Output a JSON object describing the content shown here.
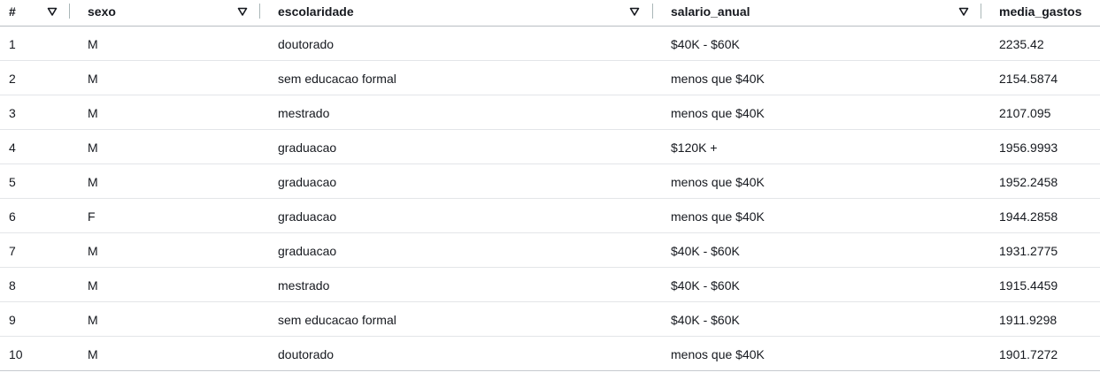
{
  "columns": [
    {
      "label": "#"
    },
    {
      "label": "sexo"
    },
    {
      "label": "escolaridade"
    },
    {
      "label": "salario_anual"
    },
    {
      "label": "media_gastos"
    }
  ],
  "rows": [
    {
      "idx": "1",
      "sexo": "M",
      "escolaridade": "doutorado",
      "salario_anual": "$40K - $60K",
      "media_gastos": "2235.42"
    },
    {
      "idx": "2",
      "sexo": "M",
      "escolaridade": "sem educacao formal",
      "salario_anual": "menos que $40K",
      "media_gastos": "2154.5874"
    },
    {
      "idx": "3",
      "sexo": "M",
      "escolaridade": "mestrado",
      "salario_anual": "menos que $40K",
      "media_gastos": "2107.095"
    },
    {
      "idx": "4",
      "sexo": "M",
      "escolaridade": "graduacao",
      "salario_anual": "$120K +",
      "media_gastos": "1956.9993"
    },
    {
      "idx": "5",
      "sexo": "M",
      "escolaridade": "graduacao",
      "salario_anual": "menos que $40K",
      "media_gastos": "1952.2458"
    },
    {
      "idx": "6",
      "sexo": "F",
      "escolaridade": "graduacao",
      "salario_anual": "menos que $40K",
      "media_gastos": "1944.2858"
    },
    {
      "idx": "7",
      "sexo": "M",
      "escolaridade": "graduacao",
      "salario_anual": "$40K - $60K",
      "media_gastos": "1931.2775"
    },
    {
      "idx": "8",
      "sexo": "M",
      "escolaridade": "mestrado",
      "salario_anual": "$40K - $60K",
      "media_gastos": "1915.4459"
    },
    {
      "idx": "9",
      "sexo": "M",
      "escolaridade": "sem educacao formal",
      "salario_anual": "$40K - $60K",
      "media_gastos": "1911.9298"
    },
    {
      "idx": "10",
      "sexo": "M",
      "escolaridade": "doutorado",
      "salario_anual": "menos que $40K",
      "media_gastos": "1901.7272"
    }
  ],
  "icons": {
    "sort": "sort-triangle-icon"
  },
  "colors": {
    "text": "#16191f",
    "header_border": "#b9bec3",
    "row_border": "#e3e5e8",
    "divider": "#aab7b8"
  }
}
